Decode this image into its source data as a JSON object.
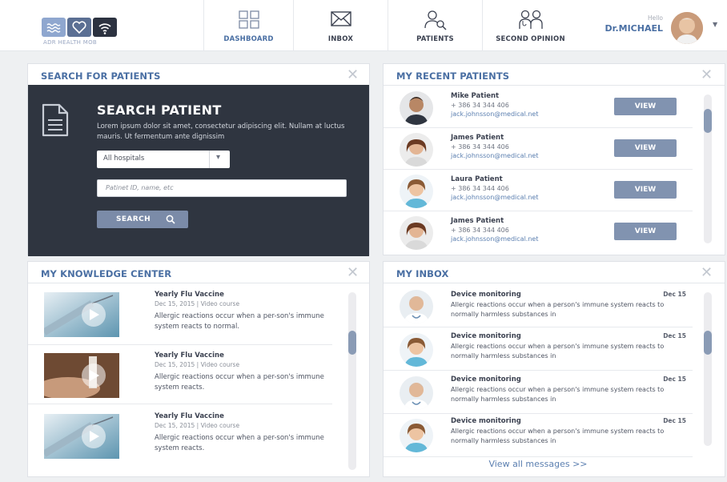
{
  "header": {
    "logo_text": "ADR HEALTH MOB",
    "nav": [
      {
        "label": "DASHBOARD",
        "icon": "dashboard-icon",
        "color": "#4a6fa3"
      },
      {
        "label": "INBOX",
        "icon": "envelope-icon",
        "color": "#3b4150"
      },
      {
        "label": "PATIENTS",
        "icon": "patient-search-icon",
        "color": "#3b4150"
      },
      {
        "label": "SECOND OPINION",
        "icon": "doctors-icon",
        "color": "#3b4150"
      }
    ],
    "greeting": "Hello",
    "user_name": "Dr.MICHAEL"
  },
  "colors": {
    "accent": "#4a6fa3",
    "dark_panel": "#2f3540",
    "button": "#7b8ba8"
  },
  "search_panel": {
    "title": "SEARCH FOR PATIENTS",
    "heading": "SEARCH PATIENT",
    "description": "Lorem ipsum dolor sit amet, consectetur adipiscing elit. Nullam at luctus mauris. Ut fermentum ante dignissim",
    "hospital_select": "All hospitals",
    "id_placeholder": "Patinet ID, name, etc",
    "search_button": "SEARCH"
  },
  "recent_patients": {
    "title": "MY RECENT PATIENTS",
    "view_label": "VIEW",
    "patients": [
      {
        "name": "Mike Patient",
        "phone": "+ 386 34 344 406",
        "email": "jack.johnsson@medical.net"
      },
      {
        "name": "James Patient",
        "phone": "+ 386 34 344 406",
        "email": "jack.johnsson@medical.net"
      },
      {
        "name": "Laura Patient",
        "phone": "+ 386 34 344 406",
        "email": "jack.johnsson@medical.net"
      },
      {
        "name": "James Patient",
        "phone": "+ 386 34 344 406",
        "email": "jack.johnsson@medical.net"
      }
    ]
  },
  "knowledge_center": {
    "title": "MY KNOWLEDGE CENTER",
    "items": [
      {
        "title": "Yearly Flu Vaccine",
        "meta": "Dec 15, 2015 | Video course",
        "text": "Allergic reactions occur when a per-son's immune system reacts to normal."
      },
      {
        "title": "Yearly Flu Vaccine",
        "meta": "Dec 15, 2015 | Video course",
        "text": "Allergic reactions occur when a per-son's immune system reacts."
      },
      {
        "title": "Yearly Flu Vaccine",
        "meta": "Dec 15, 2015 | Video course",
        "text": "Allergic reactions occur when a per-son's immune system reacts."
      }
    ]
  },
  "inbox": {
    "title": "MY INBOX",
    "messages": [
      {
        "title": "Device monitoring",
        "date": "Dec 15",
        "text": "Allergic reactions occur when a person's immune system reacts to normally harmless substances in"
      },
      {
        "title": "Device monitoring",
        "date": "Dec 15",
        "text": "Allergic reactions occur when a person's immune system reacts to normally harmless substances in"
      },
      {
        "title": "Device monitoring",
        "date": "Dec 15",
        "text": "Allergic reactions occur when a person's immune system reacts to normally harmless substances in"
      },
      {
        "title": "Device monitoring",
        "date": "Dec 15",
        "text": "Allergic reactions occur when a person's immune system reacts to normally harmless substances in"
      }
    ],
    "view_all": "View all messages >>"
  }
}
